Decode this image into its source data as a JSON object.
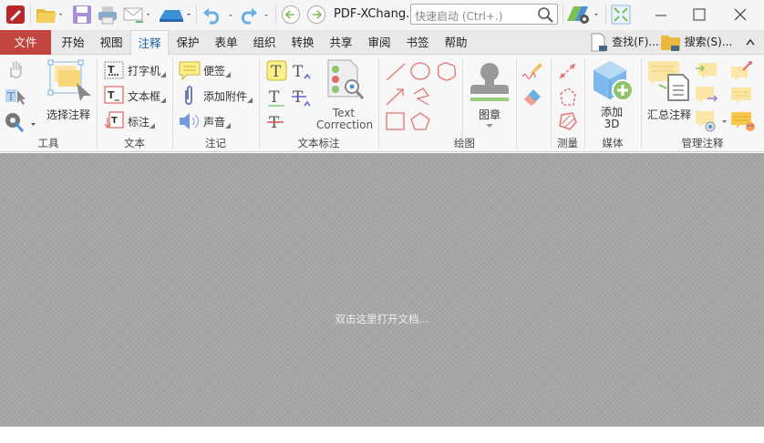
{
  "titlebar": {
    "title": "PDF-XChang..",
    "quick_launch_placeholder": "快速启动 (Ctrl+.)"
  },
  "tabs": [
    {
      "label": "文件"
    },
    {
      "label": "开始"
    },
    {
      "label": "视图"
    },
    {
      "label": "注释"
    },
    {
      "label": "保护"
    },
    {
      "label": "表单"
    },
    {
      "label": "组织"
    },
    {
      "label": "转换"
    },
    {
      "label": "共享"
    },
    {
      "label": "审阅"
    },
    {
      "label": "书签"
    },
    {
      "label": "帮助"
    }
  ],
  "tabbar_right": {
    "find": "查找(F)...",
    "search": "搜索(S)..."
  },
  "ribbon": {
    "groups": {
      "tools": "工具",
      "text": "文本",
      "notes": "注记",
      "text_markup": "文本标注",
      "drawing": "绘图",
      "measure": "测量",
      "media": "媒体",
      "manage": "管理注释"
    },
    "select_comments": "选择注释",
    "typewriter": "打字机",
    "textbox": "文本框",
    "callout": "标注",
    "sticky_note": "便签",
    "attach_file": "添加附件",
    "sound": "声音",
    "text_correction_1": "Text",
    "text_correction_2": "Correction",
    "stamp": "图章",
    "add_3d_1": "添加",
    "add_3d_2": "3D",
    "summarize": "汇总注释"
  },
  "workspace": {
    "hint": "双击这里打开文档..."
  }
}
